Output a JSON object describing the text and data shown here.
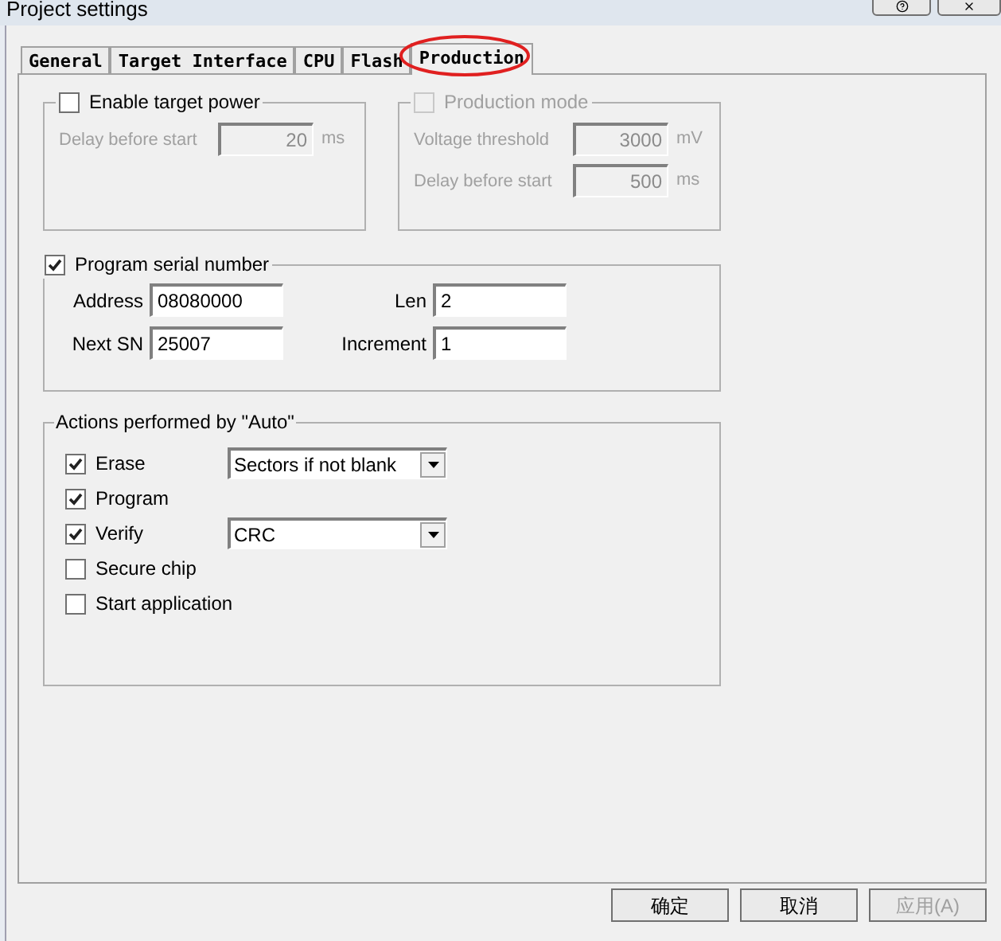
{
  "window": {
    "title": "Project settings"
  },
  "tabs": [
    {
      "label": "General",
      "selected": false
    },
    {
      "label": "Target Interface",
      "selected": false
    },
    {
      "label": "CPU",
      "selected": false
    },
    {
      "label": "Flash",
      "selected": false
    },
    {
      "label": "Production",
      "selected": true,
      "highlighted": true
    }
  ],
  "target_power": {
    "label": "Enable target power",
    "checked": false,
    "fields": [
      {
        "label": "Delay before start",
        "value": "20",
        "unit": "ms",
        "disabled": true
      }
    ]
  },
  "production_mode": {
    "label": "Production mode",
    "checked": false,
    "disabled": true,
    "fields": [
      {
        "label": "Voltage threshold",
        "value": "3000",
        "unit": "mV",
        "disabled": true
      },
      {
        "label": "Delay before start",
        "value": "500",
        "unit": "ms",
        "disabled": true
      }
    ]
  },
  "serial_number": {
    "label": "Program serial number",
    "checked": true,
    "fields": [
      {
        "label": "Address",
        "value": "08080000"
      },
      {
        "label": "Len",
        "value": "2"
      },
      {
        "label": "Next SN",
        "value": "25007"
      },
      {
        "label": "Increment",
        "value": "1"
      }
    ]
  },
  "auto_actions": {
    "label": "Actions performed by \"Auto\"",
    "items": [
      {
        "label": "Erase",
        "checked": true,
        "dropdown": "Sectors if not blank"
      },
      {
        "label": "Program",
        "checked": true
      },
      {
        "label": "Verify",
        "checked": true,
        "dropdown": "CRC"
      },
      {
        "label": "Secure chip",
        "checked": false
      },
      {
        "label": "Start application",
        "checked": false
      }
    ]
  },
  "buttons": [
    {
      "label": "确定",
      "disabled": false
    },
    {
      "label": "取消",
      "disabled": false
    },
    {
      "label": "应用(A)",
      "disabled": true
    }
  ]
}
